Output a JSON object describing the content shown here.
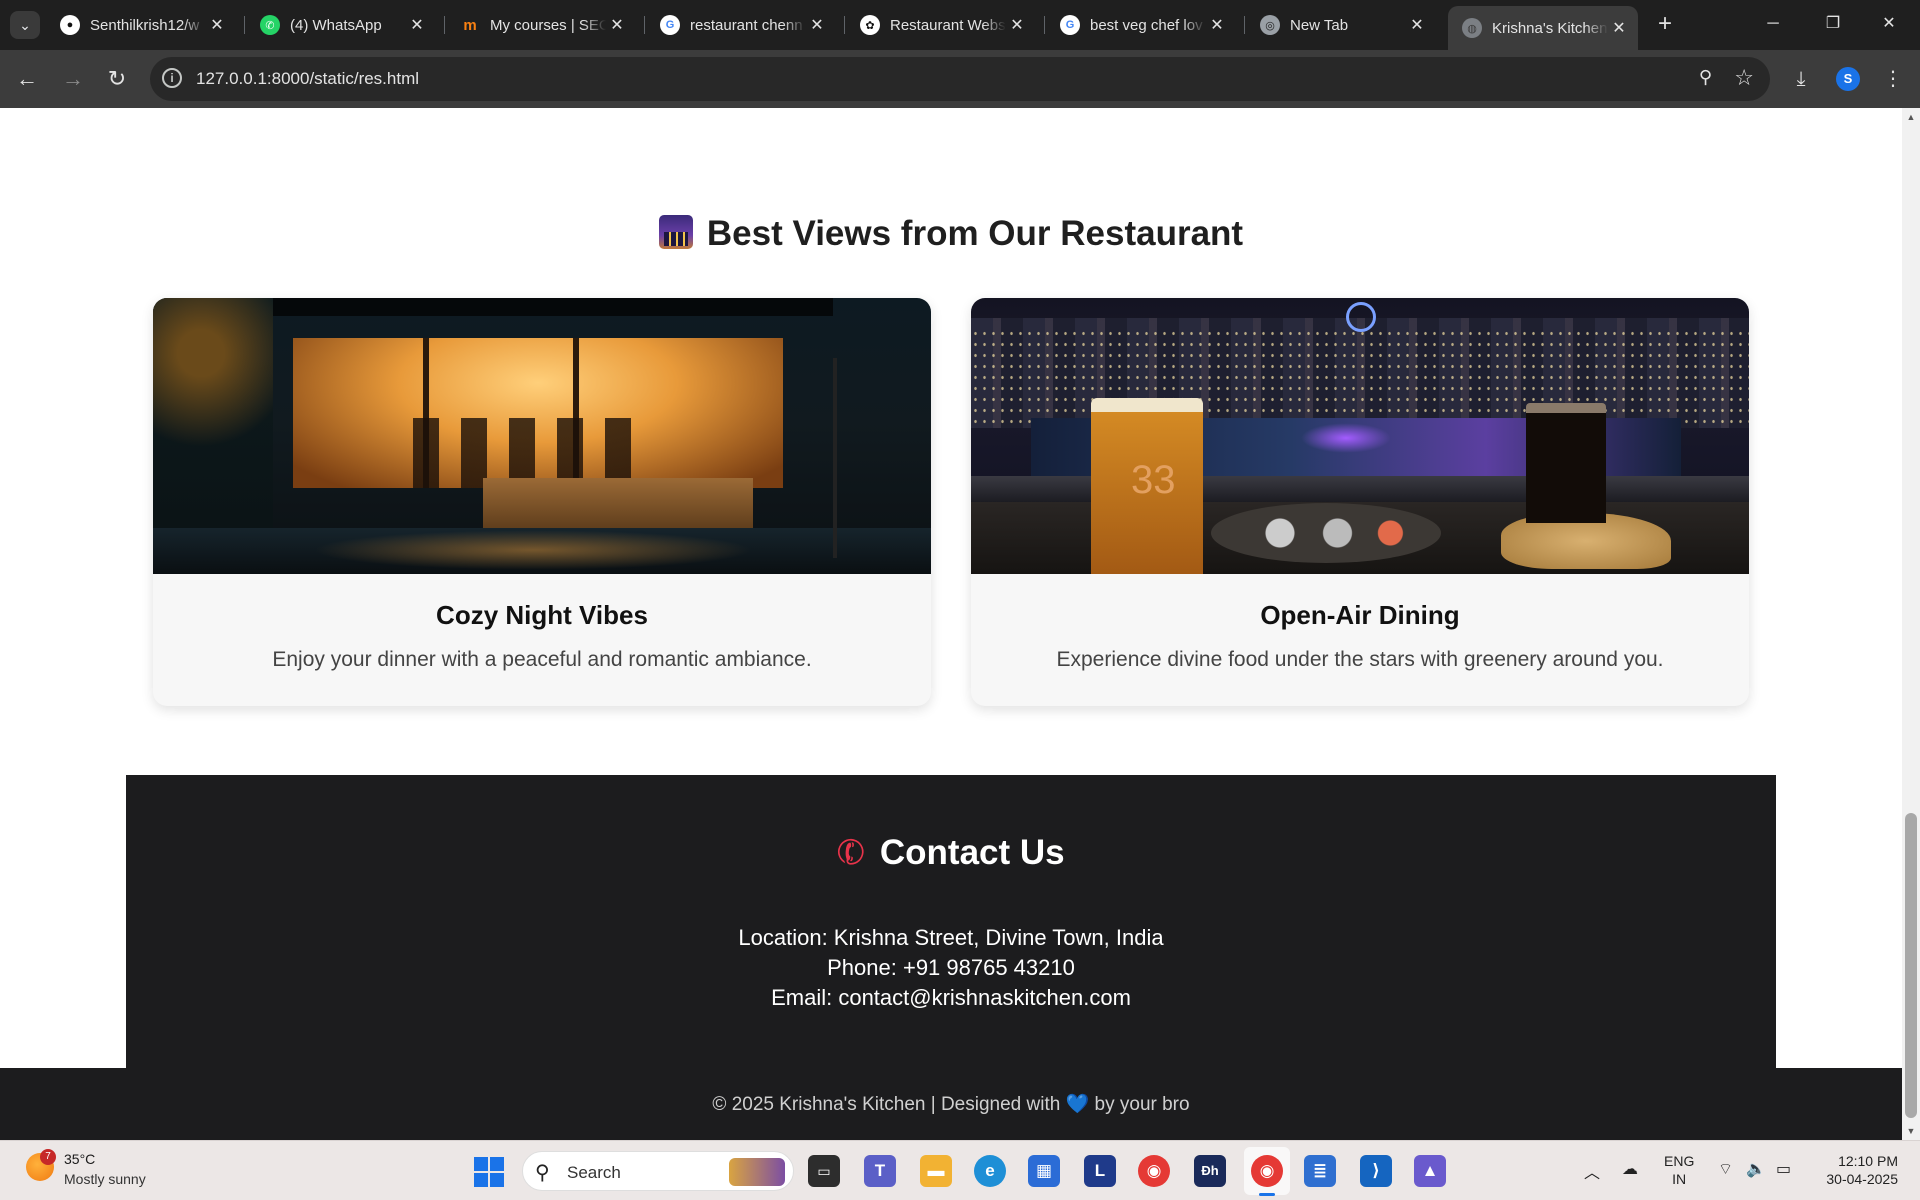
{
  "browser": {
    "tabs": [
      {
        "title": "Senthilkrish12/w",
        "icon": "github-icon",
        "color": "#ffffff"
      },
      {
        "title": "(4) WhatsApp",
        "icon": "whatsapp-icon",
        "color": "#25d366"
      },
      {
        "title": "My courses | SEC",
        "icon": "moodle-icon",
        "color": "#f98012"
      },
      {
        "title": "restaurant chenn",
        "icon": "google-icon",
        "color": "#4285f4"
      },
      {
        "title": "Restaurant Webs",
        "icon": "openai-icon",
        "color": "#ffffff"
      },
      {
        "title": "best veg chef lov",
        "icon": "google-icon",
        "color": "#4285f4"
      },
      {
        "title": "New Tab",
        "icon": "chrome-icon",
        "color": "#9aa0a6"
      },
      {
        "title": "Krishna's Kitchen",
        "icon": "globe-icon",
        "color": "#9aa0a6"
      }
    ],
    "url": "127.0.0.1:8000/static/res.html",
    "profile_initial": "S"
  },
  "page": {
    "views_title": "Best Views from Our Restaurant",
    "cards": [
      {
        "title": "Cozy Night Vibes",
        "text": "Enjoy your dinner with a peaceful and romantic ambiance."
      },
      {
        "title": "Open-Air Dining",
        "text": "Experience divine food under the stars with greenery around you."
      }
    ],
    "contact": {
      "title": "Contact Us",
      "location": "Location: Krishna Street, Divine Town, India",
      "phone": "Phone: +91 98765 43210",
      "email": "Email: contact@krishnaskitchen.com"
    },
    "footer": {
      "before": "© 2025 Krishna's Kitchen | Designed with",
      "heart": "💙",
      "after": "by your bro"
    }
  },
  "taskbar": {
    "weather_badge": "7",
    "weather_temp": "35°C",
    "weather_desc": "Mostly sunny",
    "search_label": "Search",
    "lang_line1": "ENG",
    "lang_line2": "IN",
    "time": "12:10 PM",
    "date": "30-04-2025"
  }
}
